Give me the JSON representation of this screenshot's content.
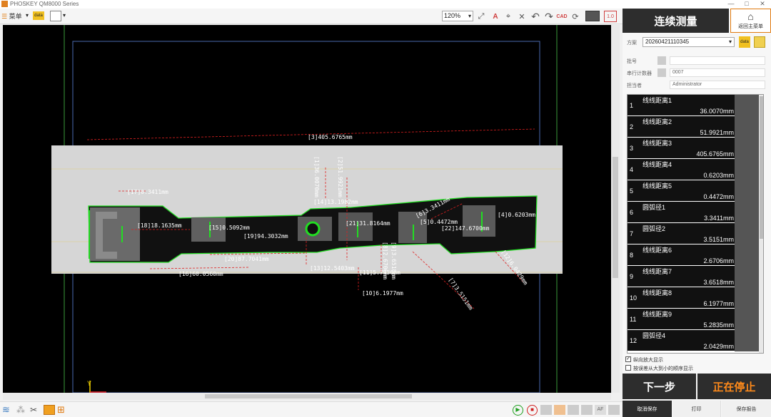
{
  "window": {
    "title": "PHOSKEY QM8000 Series",
    "minimize": "—",
    "maximize": "□",
    "close": "✕"
  },
  "toolbar": {
    "menu_label": "菜单",
    "data_label": "data",
    "zoom": "120%"
  },
  "panel": {
    "title": "连续测量",
    "home_label": "返回主菜单",
    "scheme_label": "方案",
    "scheme_value": "20260421110345",
    "batch_label": "批号",
    "counter_label": "串行计数器",
    "counter_value": "0007",
    "operator_label": "担当者",
    "operator_value": "Administrator",
    "results": [
      {
        "num": "1",
        "name": "线线距离1",
        "value": "36.0070mm"
      },
      {
        "num": "2",
        "name": "线线距离2",
        "value": "51.9921mm"
      },
      {
        "num": "3",
        "name": "线线距离3",
        "value": "405.6765mm"
      },
      {
        "num": "4",
        "name": "线线距离4",
        "value": "0.6203mm"
      },
      {
        "num": "5",
        "name": "线线距离5",
        "value": "0.4472mm"
      },
      {
        "num": "6",
        "name": "圆弧径1",
        "value": "3.3411mm"
      },
      {
        "num": "7",
        "name": "圆弧径2",
        "value": "3.5151mm"
      },
      {
        "num": "8",
        "name": "线线距离6",
        "value": "2.6706mm"
      },
      {
        "num": "9",
        "name": "线线距离7",
        "value": "3.6518mm"
      },
      {
        "num": "10",
        "name": "线线距离8",
        "value": "6.1977mm"
      },
      {
        "num": "11",
        "name": "线线距离9",
        "value": "5.2835mm"
      },
      {
        "num": "12",
        "name": "圆弧径4",
        "value": "2.0429mm"
      }
    ],
    "check1": "纵向放大显示",
    "check2": "按误差从大到小的顺序显示",
    "next_label": "下一步",
    "stop_label": "正在停止",
    "cancel_save": "取消保存",
    "print": "打印",
    "save_report": "保存报告"
  },
  "measurements": [
    {
      "text": "[3]405.6765mm"
    },
    {
      "text": "[17]0.3411mm"
    },
    {
      "text": "[18]18.1635mm"
    },
    {
      "text": "[15]0.5092mm"
    },
    {
      "text": "[19]94.3032mm"
    },
    {
      "text": "[14]13.1982mm"
    },
    {
      "text": "[21]31.8164mm"
    },
    {
      "text": "[6]3.3411mm"
    },
    {
      "text": "[5]0.4472mm"
    },
    {
      "text": "[22]147.6700mm"
    },
    {
      "text": "[4]0.6203mm"
    },
    {
      "text": "[20]87.7041mm"
    },
    {
      "text": "[16]60.0560mm"
    },
    {
      "text": "[13]12.5403mm"
    },
    {
      "text": "[11]5.7936mm"
    },
    {
      "text": "[10]6.1977mm"
    },
    {
      "text": "[7]3.5151mm"
    },
    {
      "text": "[12]6.0429mm"
    },
    {
      "text": "[1]36.0070mm"
    },
    {
      "text": "[2]51.9921mm"
    },
    {
      "text": "[8]2.6706mm"
    },
    {
      "text": "[9]3.6518mm"
    }
  ],
  "axis": {
    "y": "Y",
    "x": "X"
  },
  "colors": {
    "accent": "#e07a10",
    "stop_text": "#ff8a1a",
    "panel_dark": "#2d2d2d",
    "measure_red": "#e02020",
    "contour_green": "#22dd22"
  }
}
